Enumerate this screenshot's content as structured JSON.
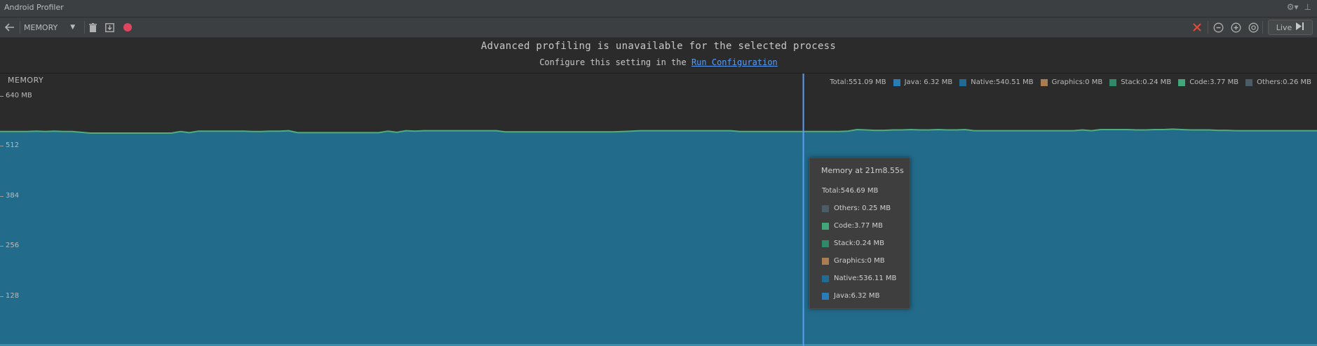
{
  "window": {
    "title": "Android Profiler"
  },
  "toolbar": {
    "stage": "MEMORY",
    "live_label": "Live"
  },
  "banner": {
    "headline": "Advanced profiling is unavailable for the selected process",
    "sub_prefix": "Configure this setting in the",
    "link_text": "Run Configuration"
  },
  "colors": {
    "java": "#2a7cb6",
    "native": "#1f6b93",
    "graphics": "#a87d52",
    "stack": "#2f8a6a",
    "code": "#41a77a",
    "others": "#4a5c66",
    "area_fill": "#226b8b",
    "area_top": "#4fae7e",
    "cursor": "#589df6"
  },
  "legend": {
    "total": "Total:551.09 MB",
    "items": [
      {
        "key": "java",
        "label": "Java:  6.32 MB",
        "color": "#2a7cb6"
      },
      {
        "key": "native",
        "label": "Native:540.51 MB",
        "color": "#1f6b93"
      },
      {
        "key": "graphics",
        "label": "Graphics:0 MB",
        "color": "#a87d52"
      },
      {
        "key": "stack",
        "label": "Stack:0.24 MB",
        "color": "#2f8a6a"
      },
      {
        "key": "code",
        "label": "Code:3.77 MB",
        "color": "#41a77a"
      },
      {
        "key": "others",
        "label": "Others:0.26 MB",
        "color": "#4a5c66"
      }
    ]
  },
  "tooltip": {
    "title": "Memory at 21m8.55s",
    "total": "Total:546.69 MB",
    "rows": [
      {
        "label": "Others: 0.25 MB",
        "color": "#4a5c66"
      },
      {
        "label": "Code:3.77 MB",
        "color": "#41a77a"
      },
      {
        "label": "Stack:0.24 MB",
        "color": "#2f8a6a"
      },
      {
        "label": "Graphics:0 MB",
        "color": "#a87d52"
      },
      {
        "label": "Native:536.11 MB",
        "color": "#1f6b93"
      },
      {
        "label": "Java:6.32 MB",
        "color": "#2a7cb6"
      }
    ]
  },
  "chart_data": {
    "type": "area",
    "title": "MEMORY",
    "ylabel": "",
    "ylim": [
      0,
      640
    ],
    "y_ticks": [
      {
        "value": 640,
        "label": "640 MB"
      },
      {
        "value": 512,
        "label": "512"
      },
      {
        "value": 384,
        "label": "384"
      },
      {
        "value": 256,
        "label": "256"
      },
      {
        "value": 128,
        "label": "128"
      }
    ],
    "cursor_fraction": 0.61,
    "series": [
      {
        "name": "Total",
        "values": [
          549,
          549,
          549,
          549,
          550,
          549,
          550,
          549,
          549,
          547,
          545,
          545,
          545,
          545,
          545,
          545,
          545,
          545,
          545,
          545,
          549,
          546,
          550,
          550,
          550,
          550,
          550,
          550,
          549,
          549,
          550,
          550,
          551,
          546,
          546,
          546,
          546,
          546,
          546,
          546,
          546,
          546,
          546,
          550,
          547,
          551,
          550,
          551,
          551,
          551,
          551,
          551,
          551,
          551,
          551,
          551,
          548,
          548,
          548,
          548,
          548,
          548,
          548,
          548,
          548,
          548,
          548,
          548,
          548,
          549,
          550,
          551,
          551,
          551,
          551,
          551,
          551,
          551,
          551,
          551,
          551,
          551,
          549,
          549,
          549,
          549,
          549,
          549,
          549,
          549,
          549,
          549,
          549,
          549,
          550,
          554,
          553,
          552,
          552,
          553,
          553,
          554,
          553,
          553,
          554,
          553,
          553,
          554,
          551,
          551,
          551,
          551,
          551,
          551,
          551,
          551,
          551,
          551,
          551,
          551,
          553,
          551,
          554,
          554,
          554,
          554,
          553,
          553,
          554,
          554,
          555,
          554,
          553,
          553,
          553,
          552,
          552,
          551,
          551,
          551,
          551,
          551,
          551,
          551,
          551,
          551,
          551
        ]
      }
    ]
  }
}
